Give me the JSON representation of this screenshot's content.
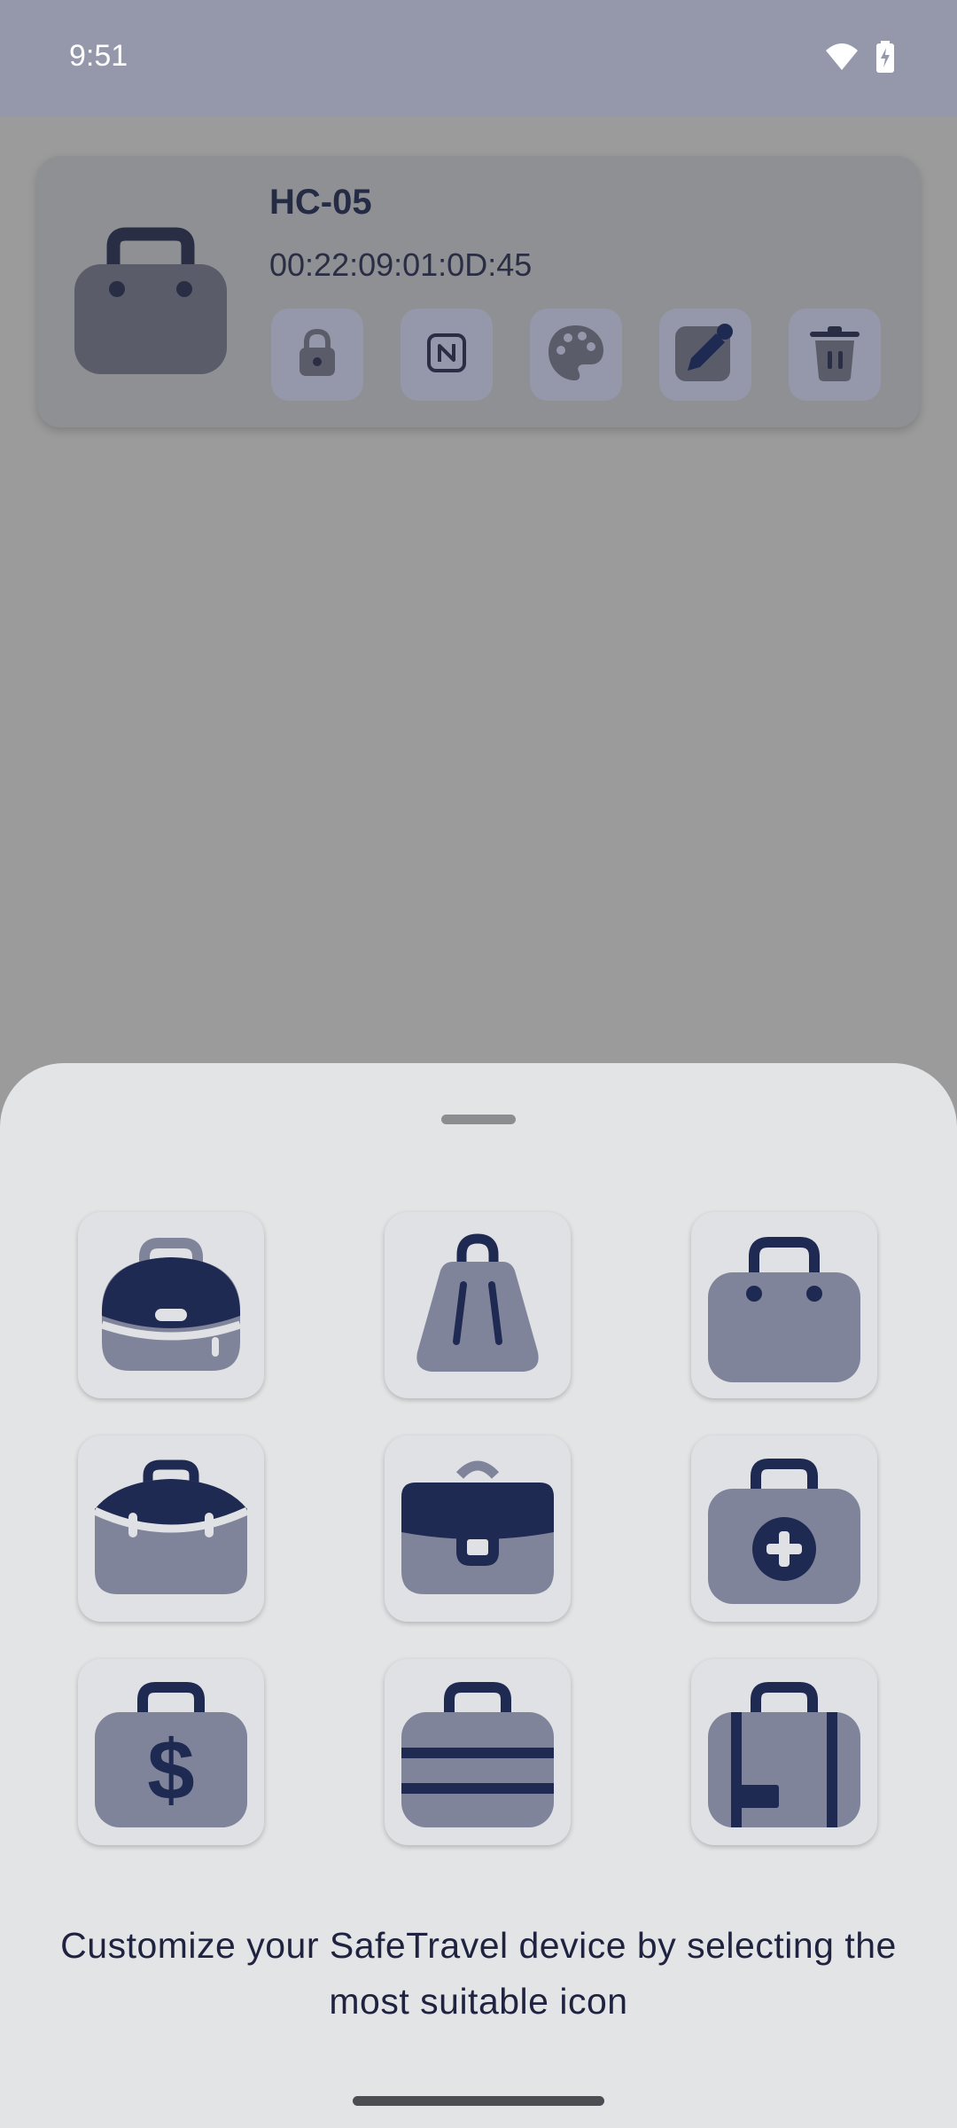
{
  "status_bar": {
    "time": "9:51",
    "icons": [
      "wifi-icon",
      "battery-charging-icon"
    ]
  },
  "device": {
    "name": "HC-05",
    "mac": "00:22:09:01:0D:45",
    "icon": "luggage-icon",
    "actions": [
      "lock-icon",
      "nfc-icon",
      "palette-icon",
      "edit-icon",
      "trash-icon"
    ]
  },
  "icon_picker": {
    "icons": [
      "backpack-icon",
      "shopping-bag-icon",
      "handbag-icon",
      "toolbag-icon",
      "briefcase-icon",
      "medical-bag-icon",
      "money-bag-icon",
      "striped-suitcase-icon",
      "tagged-suitcase-icon"
    ],
    "caption_line1": "Customize your SafeTravel device by selecting the",
    "caption_line2": "most suitable icon"
  },
  "colors": {
    "navy": "#1f2a52",
    "gray_fill": "#80849a",
    "sheet": "#e3e4e6"
  }
}
